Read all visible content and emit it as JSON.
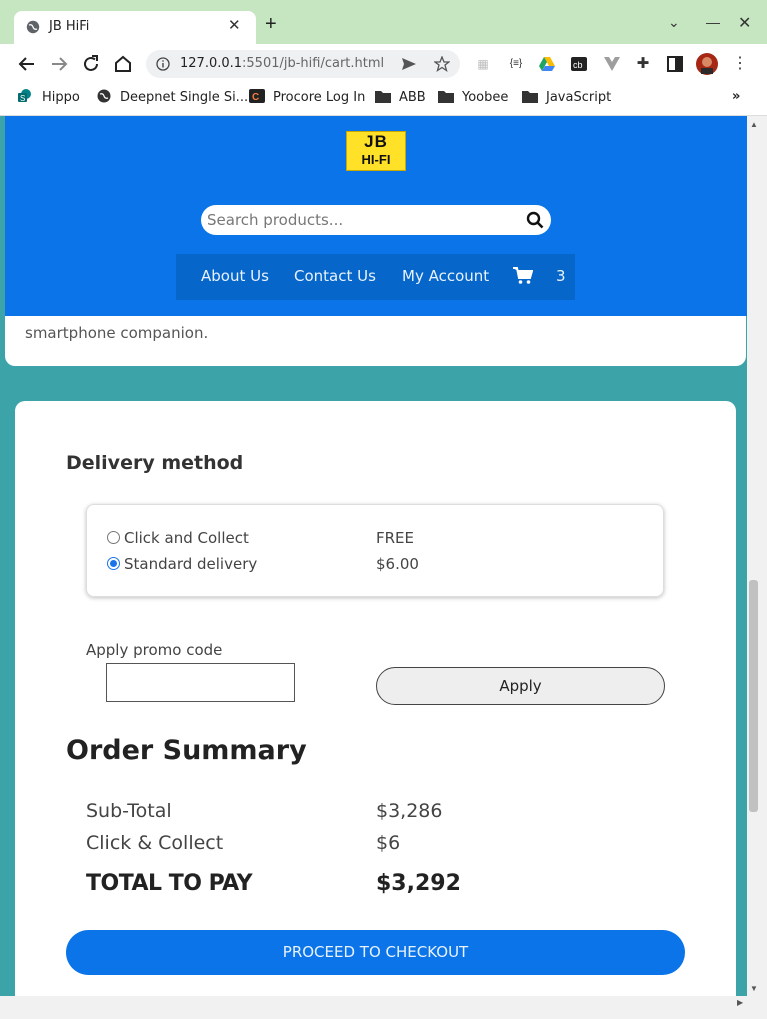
{
  "browser": {
    "tab_title": "JB HiFi",
    "url_host": "127.0.0.1",
    "url_rest": ":5501/jb-hifi/cart.html",
    "bookmarks": [
      "Hippo",
      "Deepnet Single Si...",
      "Procore Log In",
      "ABB",
      "Yoobee",
      "JavaScript"
    ],
    "more_bookmarks": "»",
    "extension_json": "{≡}"
  },
  "header": {
    "logo_line1": "JB",
    "logo_line2": "HI-FI",
    "search_placeholder": "Search products...",
    "nav": [
      "About Us",
      "Contact Us",
      "My Account"
    ],
    "cart_count": "3",
    "brand_color": "#0a74e8"
  },
  "product_text": "smartphone companion.",
  "delivery": {
    "heading": "Delivery method",
    "options": [
      {
        "label": "Click and Collect",
        "price": "FREE",
        "selected": false
      },
      {
        "label": "Standard delivery",
        "price": "$6.00",
        "selected": true
      }
    ]
  },
  "promo": {
    "label": "Apply promo code",
    "value": "",
    "apply_label": "Apply"
  },
  "summary": {
    "heading": "Order Summary",
    "subtotal_label": "Sub-Total",
    "subtotal_value": "$3,286",
    "delivery_label": "Click & Collect",
    "delivery_value": "$6",
    "total_label": "TOTAL TO PAY",
    "total_value": "$3,292",
    "checkout_label": "PROCEED TO CHECKOUT"
  }
}
